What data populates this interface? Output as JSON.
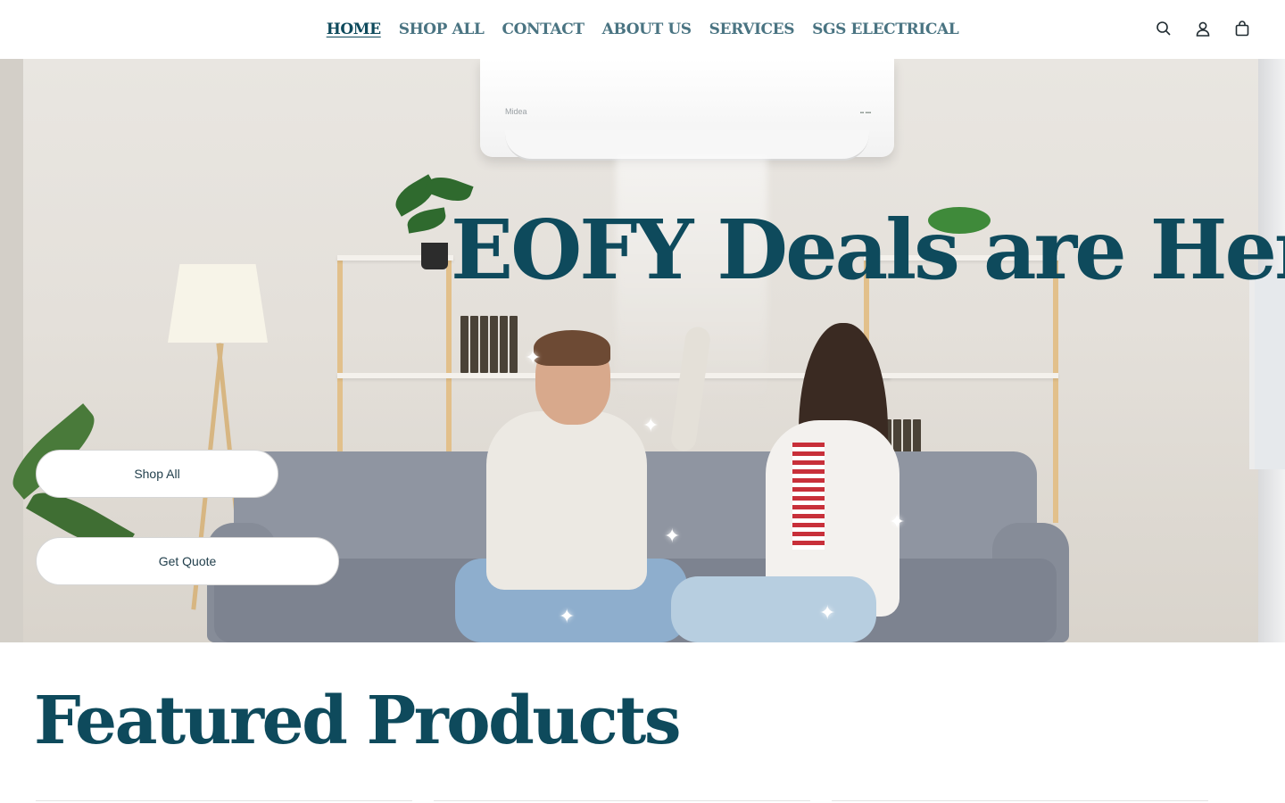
{
  "nav": {
    "items": [
      {
        "label": "HOME",
        "active": true
      },
      {
        "label": "SHOP ALL",
        "active": false
      },
      {
        "label": "CONTACT",
        "active": false
      },
      {
        "label": "ABOUT US",
        "active": false
      },
      {
        "label": "SERVICES",
        "active": false
      },
      {
        "label": "SGS ELECTRICAL",
        "active": false
      }
    ]
  },
  "header_icons": [
    "search-icon",
    "account-icon",
    "cart-icon"
  ],
  "hero": {
    "heading": "EOFY Deals are Here",
    "buttons": {
      "shop_all": "Shop All",
      "get_quote": "Get Quote"
    },
    "ac_brand": "Midea"
  },
  "featured": {
    "heading": "Featured Products"
  },
  "colors": {
    "brand_primary": "#0e4a5c",
    "nav_inactive": "#4a7482",
    "button_background": "#ffffff"
  }
}
